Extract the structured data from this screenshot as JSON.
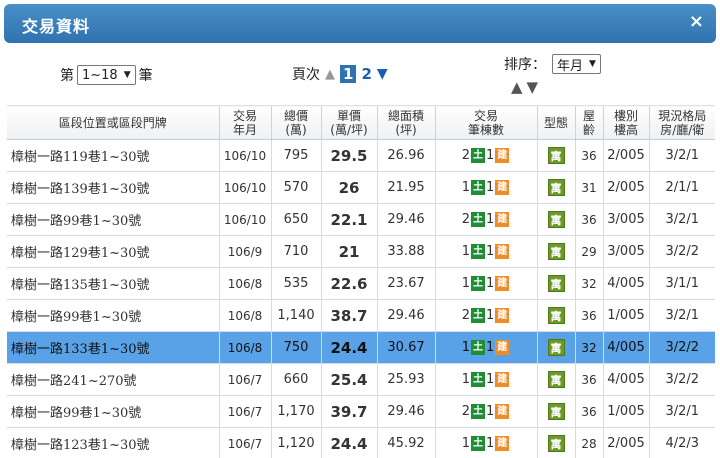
{
  "dialog": {
    "title": "交易資料",
    "close_glyph": "×"
  },
  "controls": {
    "range_prefix": "第",
    "range_value": "1~18",
    "range_suffix": "筆",
    "page_label": "頁次",
    "pages": [
      "1",
      "2"
    ],
    "current_page": "1",
    "sort_label": "排序：",
    "sort_value": "年月"
  },
  "table": {
    "columns": [
      [
        "區段位置或區段門牌"
      ],
      [
        "交易",
        "年月"
      ],
      [
        "總價",
        "(萬)"
      ],
      [
        "單價",
        "(萬/坪)"
      ],
      [
        "總面積",
        "(坪)"
      ],
      [
        "交易",
        "筆棟數"
      ],
      [
        "型態"
      ],
      [
        "屋",
        "齡"
      ],
      [
        "樓別",
        "樓高"
      ],
      [
        "現況格局",
        "房/廳/衛"
      ]
    ],
    "badge_land": "土",
    "badge_building": "建",
    "type_label": "寓",
    "rows": [
      {
        "address": "樟樹一路119巷1~30號",
        "date": "106/10",
        "total": "795",
        "unit": "29.5",
        "area": "26.96",
        "land": "2",
        "bld": "1",
        "age": "36",
        "floor": "2/005",
        "layout": "3/2/1"
      },
      {
        "address": "樟樹一路139巷1~30號",
        "date": "106/10",
        "total": "570",
        "unit": "26",
        "area": "21.95",
        "land": "1",
        "bld": "1",
        "age": "31",
        "floor": "2/005",
        "layout": "2/1/1"
      },
      {
        "address": "樟樹一路99巷1~30號",
        "date": "106/10",
        "total": "650",
        "unit": "22.1",
        "area": "29.46",
        "land": "2",
        "bld": "1",
        "age": "36",
        "floor": "3/005",
        "layout": "3/2/1"
      },
      {
        "address": "樟樹一路129巷1~30號",
        "date": "106/9",
        "total": "710",
        "unit": "21",
        "area": "33.88",
        "land": "1",
        "bld": "1",
        "age": "29",
        "floor": "3/005",
        "layout": "3/2/2"
      },
      {
        "address": "樟樹一路135巷1~30號",
        "date": "106/8",
        "total": "535",
        "unit": "22.6",
        "area": "23.67",
        "land": "1",
        "bld": "1",
        "age": "32",
        "floor": "4/005",
        "layout": "3/1/1"
      },
      {
        "address": "樟樹一路99巷1~30號",
        "date": "106/8",
        "total": "1,140",
        "unit": "38.7",
        "area": "29.46",
        "land": "2",
        "bld": "1",
        "age": "36",
        "floor": "1/005",
        "layout": "3/2/1"
      },
      {
        "address": "樟樹一路133巷1~30號",
        "date": "106/8",
        "total": "750",
        "unit": "24.4",
        "area": "30.67",
        "land": "1",
        "bld": "1",
        "age": "32",
        "floor": "4/005",
        "layout": "3/2/2",
        "selected": true
      },
      {
        "address": "樟樹一路241~270號",
        "date": "106/7",
        "total": "660",
        "unit": "25.4",
        "area": "25.93",
        "land": "1",
        "bld": "1",
        "age": "36",
        "floor": "4/005",
        "layout": "3/2/2"
      },
      {
        "address": "樟樹一路99巷1~30號",
        "date": "106/7",
        "total": "1,170",
        "unit": "39.7",
        "area": "29.46",
        "land": "2",
        "bld": "1",
        "age": "36",
        "floor": "1/005",
        "layout": "3/2/1"
      },
      {
        "address": "樟樹一路123巷1~30號",
        "date": "106/7",
        "total": "1,120",
        "unit": "24.4",
        "area": "45.92",
        "land": "1",
        "bld": "1",
        "age": "28",
        "floor": "2/005",
        "layout": "4/2/3"
      }
    ]
  }
}
